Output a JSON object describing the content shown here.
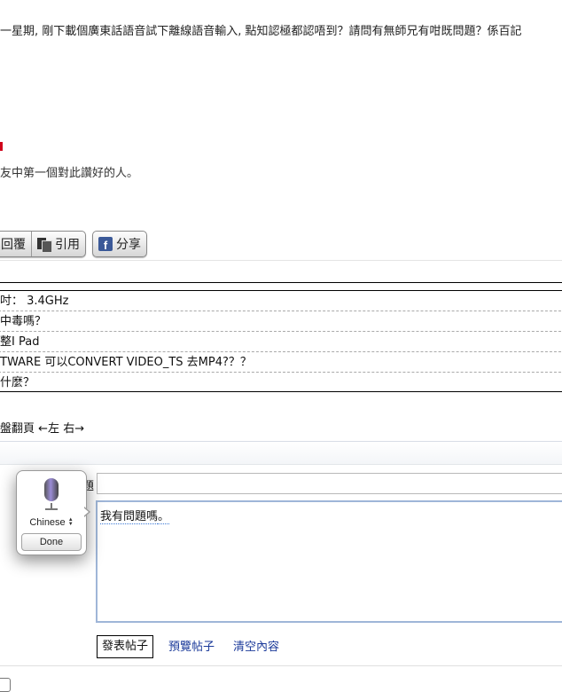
{
  "post": {
    "body_text": "一星期, 剛下載個廣東話語音試下離線語音輸入, 點知認極都認唔到？請問有無師兄有咁既問題？係百記",
    "like_text": "友中第一個對此讚好的人。"
  },
  "actions": {
    "reply_label": "回覆",
    "quote_label": "引用",
    "share_label": "分享"
  },
  "related_threads": [
    "  吋： 3.4GHz",
    "中毒嗎？",
    "整I Pad",
    "TWARE 可以CONVERT VIDEO_TS 去MP4?？？",
    "什麼？"
  ],
  "pager": {
    "label": "盤翻頁",
    "left": "←左",
    "right": "右→"
  },
  "reply_form": {
    "subject_label": "題",
    "subject_value": "",
    "content_prefix": "我有問題嗎",
    "content_suffix": "。"
  },
  "dictation": {
    "language": "Chinese",
    "done_label": "Done",
    "accent_color": "#9b8cd6"
  },
  "form_buttons": {
    "submit_label": "發表帖子",
    "preview_label": "預覽帖子",
    "clear_label": "清空內容"
  },
  "colors": {
    "link": "#1b3a9a",
    "facebook": "#3b5998",
    "editor_border": "#9fb6d8"
  }
}
